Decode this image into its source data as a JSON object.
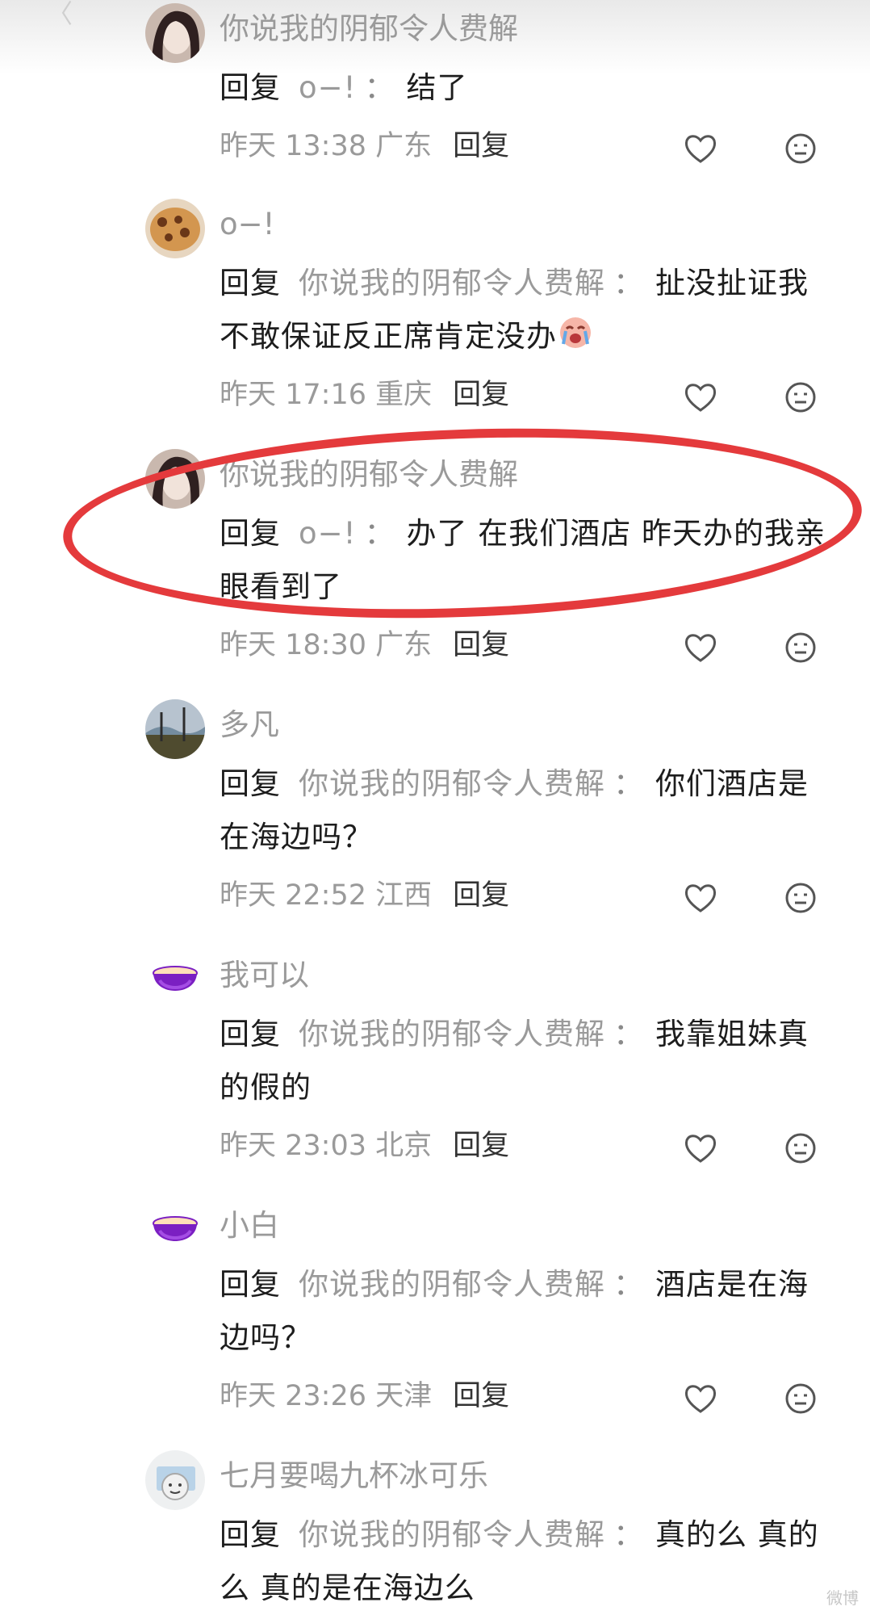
{
  "top_hint": "〈",
  "comments": [
    {
      "username": "你说我的阴郁令人费解",
      "reply_prefix": "回复",
      "reply_target": "o−!",
      "text": "结了",
      "meta": "昨天 13:38 广东",
      "reply_label": "回复",
      "avatar": "girl-photo"
    },
    {
      "username": "o−!",
      "reply_prefix": "回复",
      "reply_target": "你说我的阴郁令人费解",
      "text": "扯没扯证我不敢保证反正席肯定没办",
      "emoji": "crying-face-emoji",
      "meta": "昨天 17:16 重庆",
      "reply_label": "回复",
      "avatar": "cookie-photo"
    },
    {
      "username": "你说我的阴郁令人费解",
      "reply_prefix": "回复",
      "reply_target": "o−!",
      "text": "办了 在我们酒店 昨天办的我亲眼看到了",
      "meta": "昨天 18:30 广东",
      "reply_label": "回复",
      "avatar": "girl-photo",
      "highlighted": true
    },
    {
      "username": "多凡",
      "reply_prefix": "回复",
      "reply_target": "你说我的阴郁令人费解",
      "text": "你们酒店是在海边吗？",
      "meta": "昨天 22:52 江西",
      "reply_label": "回复",
      "avatar": "landscape-photo"
    },
    {
      "username": "我可以",
      "reply_prefix": "回复",
      "reply_target": "你说我的阴郁令人费解",
      "text": "我靠姐妹真的假的",
      "meta": "昨天 23:03 北京",
      "reply_label": "回复",
      "avatar": "purple-bowl"
    },
    {
      "username": "小白",
      "reply_prefix": "回复",
      "reply_target": "你说我的阴郁令人费解",
      "text": "酒店是在海边吗？",
      "meta": "昨天 23:26 天津",
      "reply_label": "回复",
      "avatar": "purple-bowl"
    },
    {
      "username": "七月要喝九杯冰可乐",
      "reply_prefix": "回复",
      "reply_target": "你说我的阴郁令人费解",
      "text": "真的么 真的么 真的是在海边么",
      "avatar": "cartoon-photo"
    }
  ],
  "watermark": "微博",
  "colors": {
    "highlight_oval": "#e43a3c",
    "muted_text": "#9a9a9a",
    "main_text": "#1d1d1d",
    "bowl_purple": "#7b1fc2"
  },
  "icons": {
    "like": "heart-outline-icon",
    "dislike": "meh-face-icon"
  }
}
